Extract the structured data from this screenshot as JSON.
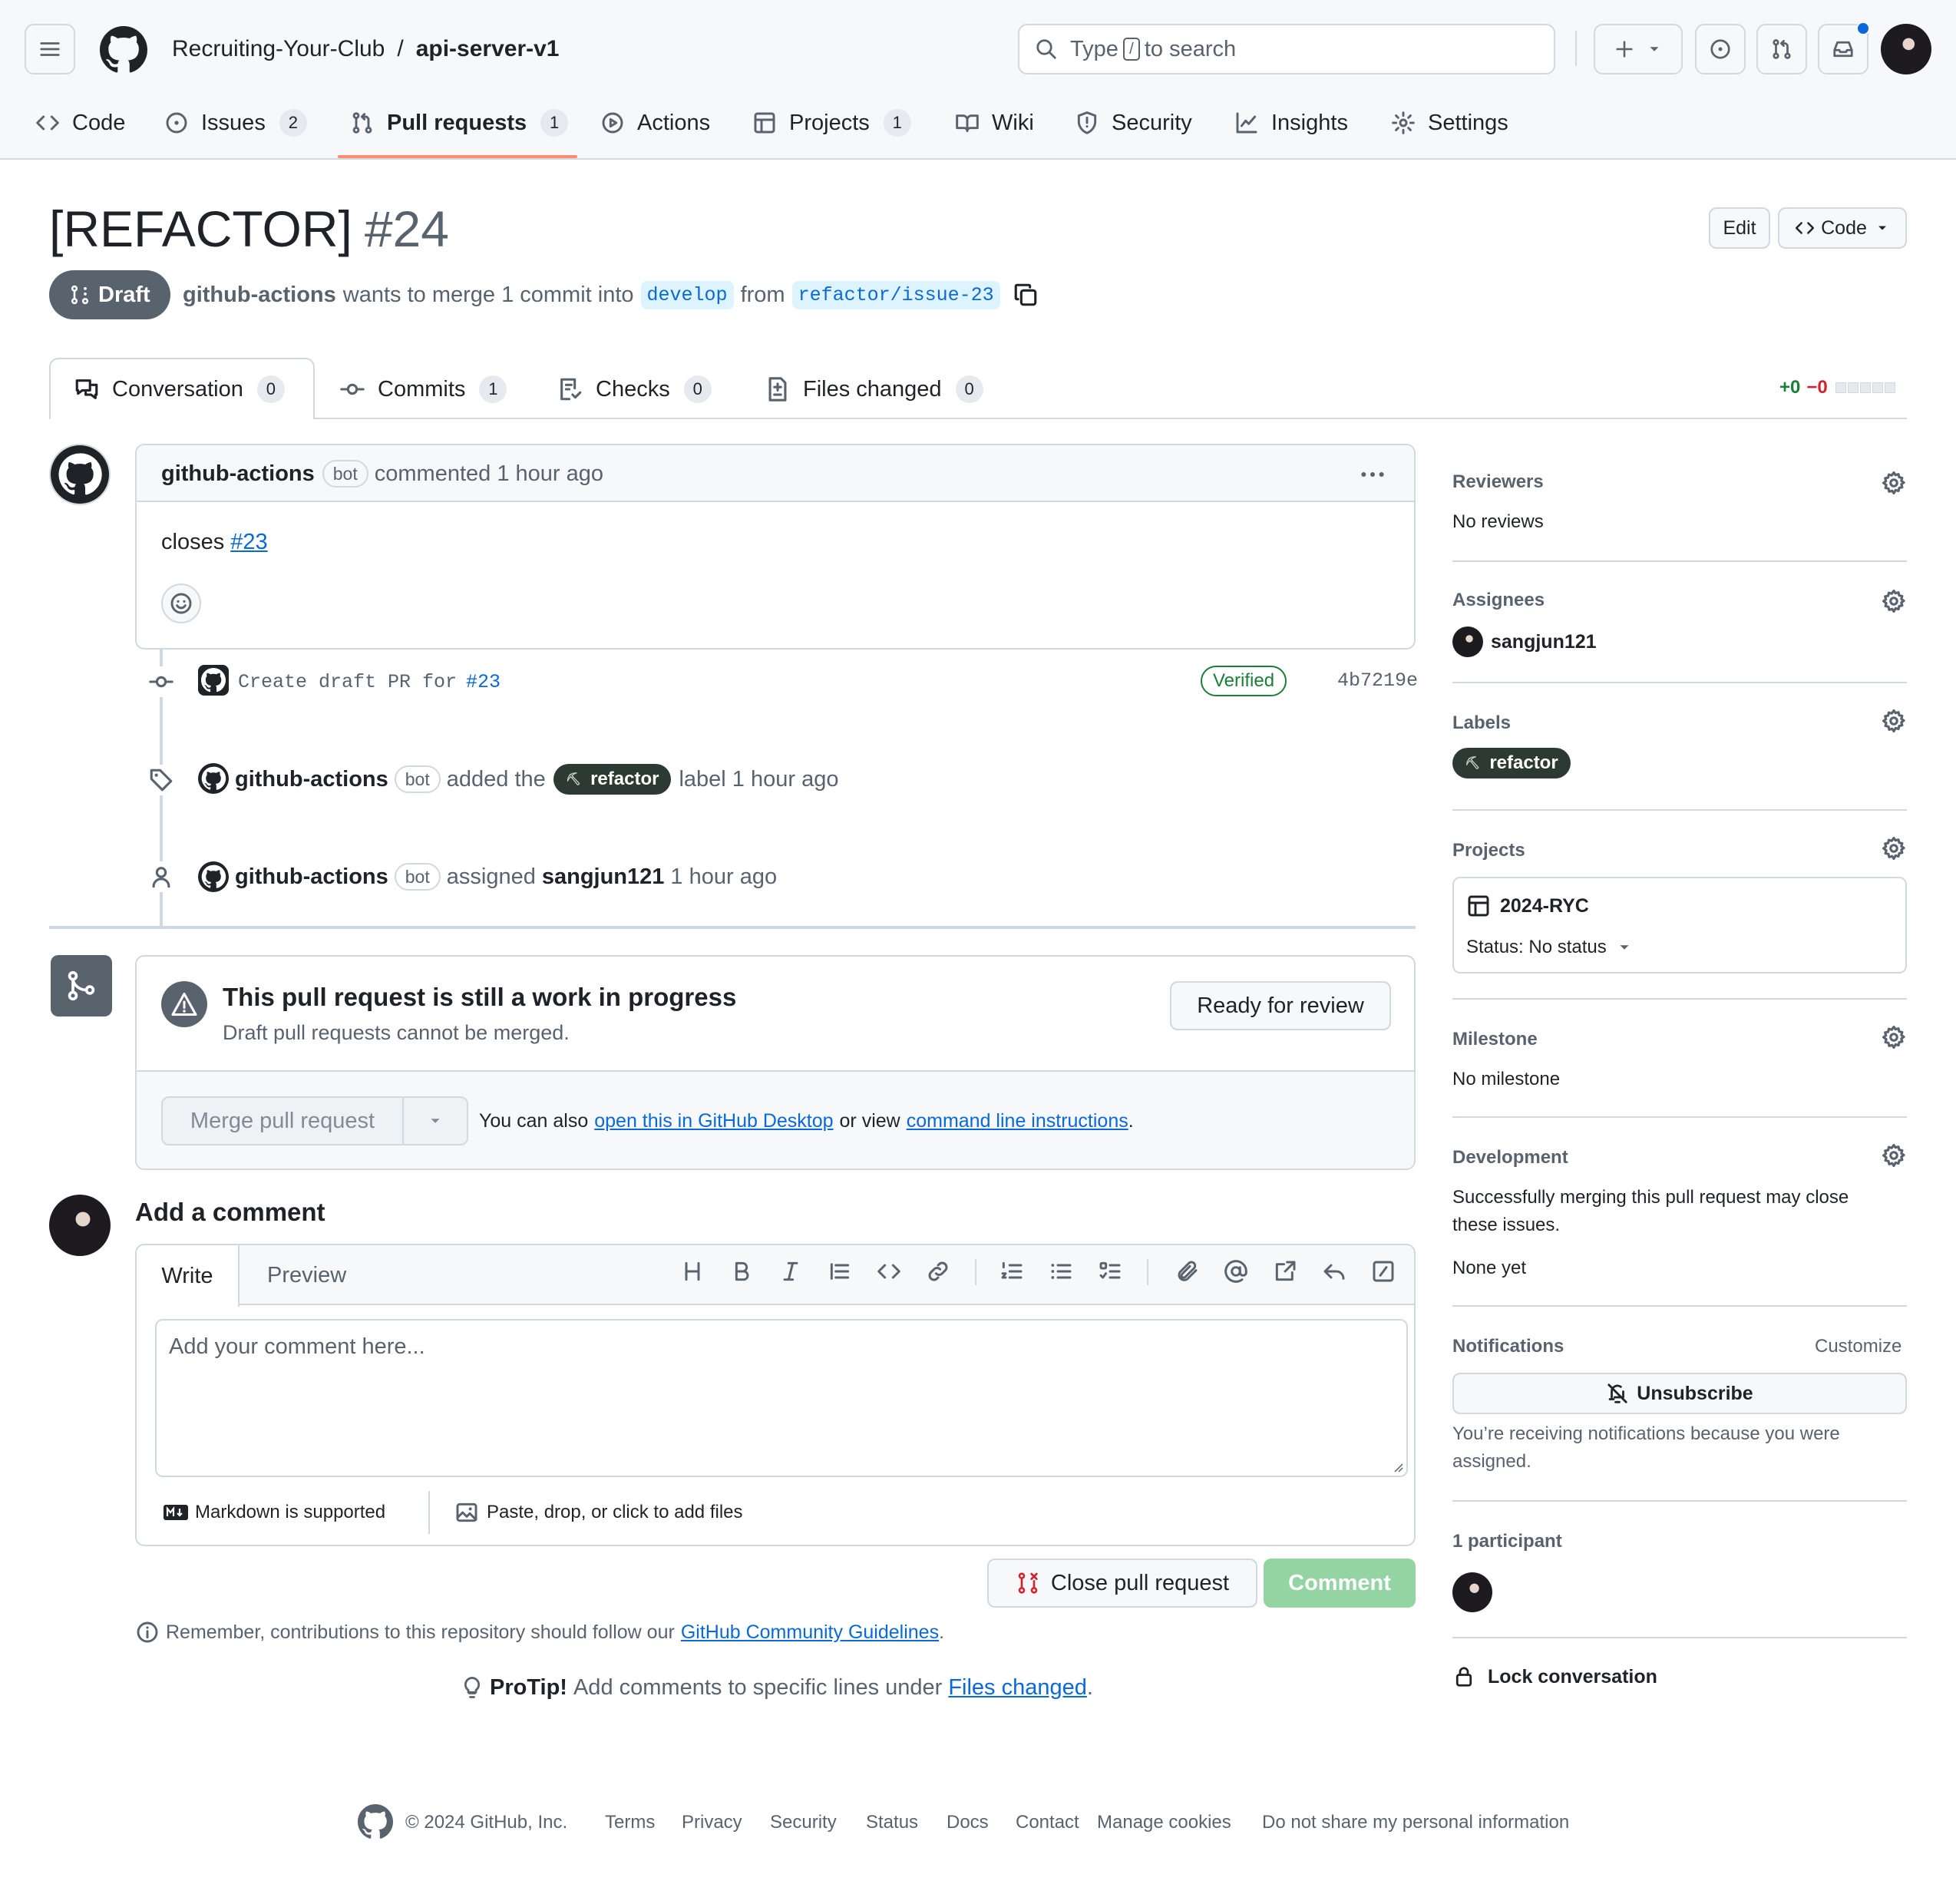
{
  "header": {
    "owner": "Recruiting-Your-Club",
    "separator": "/",
    "repo": "api-server-v1",
    "search_prefix": "Type",
    "search_key": "/",
    "search_suffix": "to search"
  },
  "nav": [
    {
      "label": "Code",
      "icon": "code-icon"
    },
    {
      "label": "Issues",
      "count": "2",
      "icon": "issue-opened-icon"
    },
    {
      "label": "Pull requests",
      "count": "1",
      "icon": "git-pull-request-icon"
    },
    {
      "label": "Actions",
      "icon": "play-icon"
    },
    {
      "label": "Projects",
      "count": "1",
      "icon": "table-icon"
    },
    {
      "label": "Wiki",
      "icon": "book-icon"
    },
    {
      "label": "Security",
      "icon": "shield-icon"
    },
    {
      "label": "Insights",
      "icon": "graph-icon"
    },
    {
      "label": "Settings",
      "icon": "gear-icon"
    }
  ],
  "pr": {
    "title": "[REFACTOR]",
    "number": "#24",
    "state": "Draft",
    "author": "github-actions",
    "summary_mid": "wants to merge 1 commit into",
    "base": "develop",
    "from_word": "from",
    "head": "refactor/issue-23",
    "edit_label": "Edit",
    "code_label": "Code"
  },
  "tabs": [
    {
      "label": "Conversation",
      "count": "0"
    },
    {
      "label": "Commits",
      "count": "1"
    },
    {
      "label": "Checks",
      "count": "0"
    },
    {
      "label": "Files changed",
      "count": "0"
    }
  ],
  "diffstat": {
    "added": "+0",
    "removed": "−0"
  },
  "comment": {
    "author": "github-actions",
    "bot": "bot",
    "meta": "commented 1 hour ago",
    "body_prefix": "closes",
    "body_link": "#23"
  },
  "timeline": {
    "commit_msg_prefix": "Create draft PR for",
    "commit_msg_link": "#23",
    "verified": "Verified",
    "sha": "4b7219e",
    "label_event_actor": "github-actions",
    "label_event_bot": "bot",
    "label_event_mid": "added the",
    "label_event_label": "refactor",
    "label_event_end": "label 1 hour ago",
    "assign_event_actor": "github-actions",
    "assign_event_bot": "bot",
    "assign_event_mid": "assigned",
    "assign_event_user": "sangjun121",
    "assign_event_end": "1 hour ago"
  },
  "merge": {
    "title": "This pull request is still a work in progress",
    "subtitle": "Draft pull requests cannot be merged.",
    "ready_button": "Ready for review",
    "merge_button": "Merge pull request",
    "also_prefix": "You can also",
    "desktop_link": "open this in GitHub Desktop",
    "or_view": "or view",
    "cli_link": "command line instructions",
    "period": "."
  },
  "new_comment": {
    "heading": "Add a comment",
    "tab_write": "Write",
    "tab_preview": "Preview",
    "placeholder": "Add your comment here...",
    "markdown": "Markdown is supported",
    "attach": "Paste, drop, or click to add files",
    "close_button": "Close pull request",
    "comment_button": "Comment",
    "guidelines_prefix": "Remember, contributions to this repository should follow our",
    "guidelines_link": "GitHub Community Guidelines",
    "period": "."
  },
  "protip": {
    "label": "ProTip!",
    "text": "Add comments to specific lines under",
    "link": "Files changed",
    "period": "."
  },
  "sidebar": {
    "reviewers_h": "Reviewers",
    "reviewers_v": "No reviews",
    "assignees_h": "Assignees",
    "assignee": "sangjun121",
    "labels_h": "Labels",
    "label": "refactor",
    "projects_h": "Projects",
    "project": "2024-RYC",
    "project_status": "Status: No status",
    "milestone_h": "Milestone",
    "milestone_v": "No milestone",
    "development_h": "Development",
    "development_text1": "Successfully merging this pull request may close",
    "development_text2": "these issues.",
    "development_v": "None yet",
    "notifications_h": "Notifications",
    "customize": "Customize",
    "unsubscribe": "Unsubscribe",
    "notif_text1": "You’re receiving notifications because you were",
    "notif_text2": "assigned.",
    "participants_h": "1 participant",
    "lock": "Lock conversation"
  },
  "footer": {
    "copyright": "© 2024 GitHub, Inc.",
    "links": [
      "Terms",
      "Privacy",
      "Security",
      "Status",
      "Docs",
      "Contact",
      "Manage cookies",
      "Do not share my personal information"
    ]
  },
  "colors": {
    "accent": "#0969da",
    "draft": "#59636e",
    "label": "#2d3a33",
    "success": "#1a7f37",
    "danger": "#d1242f",
    "comment_btn": "#94d3a2"
  }
}
